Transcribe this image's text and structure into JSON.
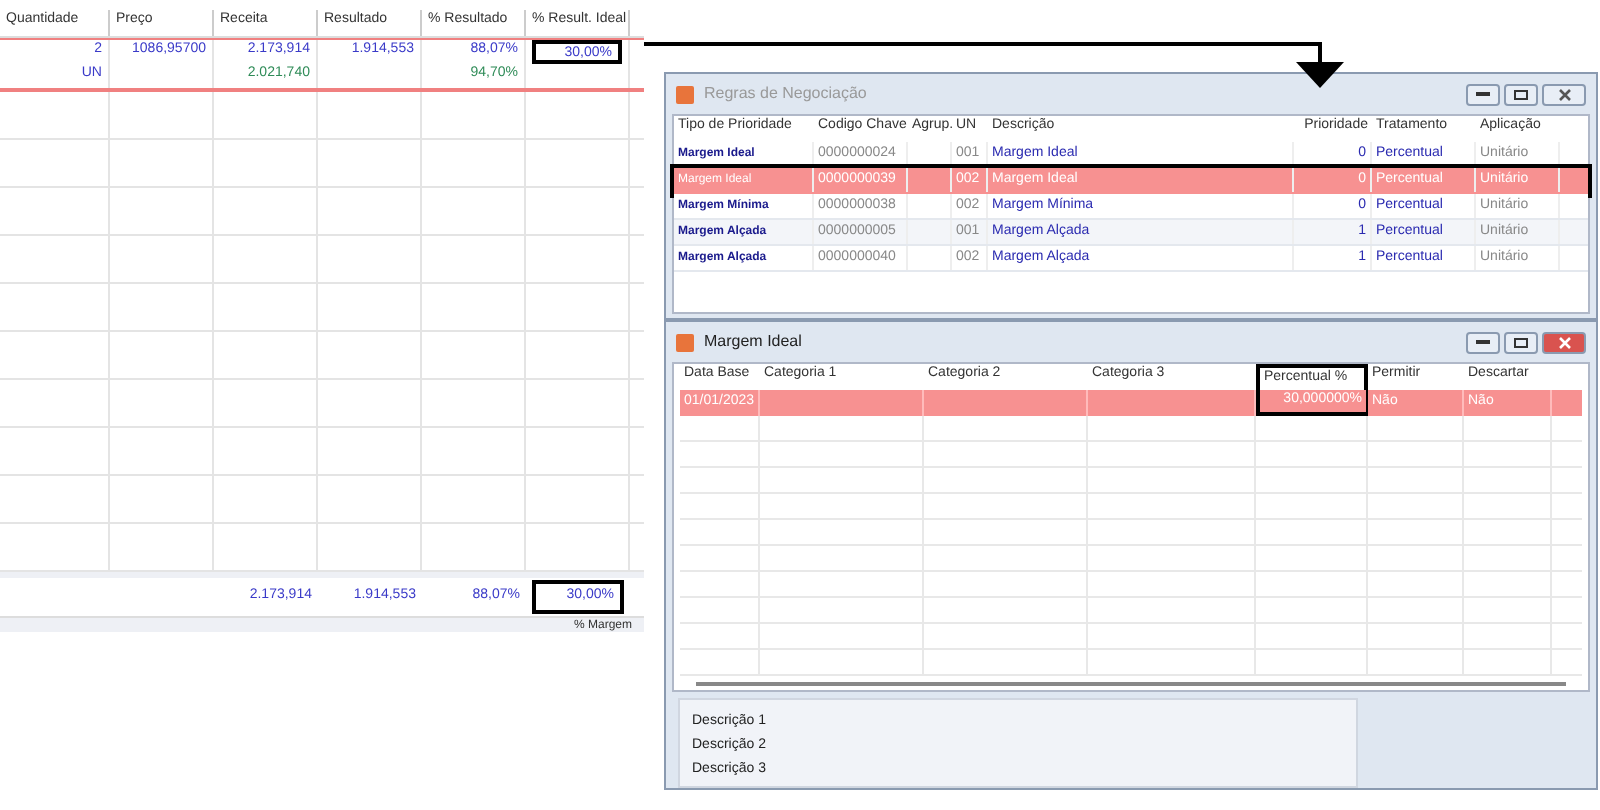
{
  "sheet": {
    "columns": [
      {
        "label": "Quantidade"
      },
      {
        "label": "Preço"
      },
      {
        "label": "Receita"
      },
      {
        "label": "Resultado"
      },
      {
        "label": "% Resultado"
      },
      {
        "label": "% Result. Ideal"
      }
    ],
    "rows": [
      {
        "cells": [
          {
            "text": "2",
            "color": "#3a3ac8"
          },
          {
            "text": "1086,95700",
            "color": "#3a3ac8"
          },
          {
            "text": "2.173,914",
            "color": "#3a3ac8"
          },
          {
            "text": "1.914,553",
            "color": "#3a3ac8"
          },
          {
            "text": "88,07%",
            "color": "#3a3ac8"
          },
          {
            "text": "30,00%",
            "color": "#3a3ac8",
            "boxed": true
          }
        ]
      },
      {
        "cells": [
          {
            "text": "UN",
            "color": "#3a3ac8"
          },
          null,
          {
            "text": "2.021,740",
            "color": "#2e8b57"
          },
          null,
          {
            "text": "94,70%",
            "color": "#2e8b57"
          },
          null
        ]
      }
    ],
    "totals": [
      {
        "text": "2.173,914"
      },
      {
        "text": "1.914,553"
      },
      {
        "text": "88,07%"
      },
      {
        "text": "30,00%",
        "boxed": true
      }
    ],
    "footer_label": "% Margem"
  },
  "rules_window": {
    "title": "Regras de Negociação",
    "columns": [
      "Tipo de Prioridade",
      "Codigo Chave",
      "Agrup.",
      "UN",
      "Descrição",
      "Prioridade",
      "Tratamento",
      "Aplicação"
    ],
    "rows": [
      {
        "cells": [
          "Margem Ideal",
          "0000000024",
          null,
          "001",
          "Margem Ideal",
          "0",
          "Percentual",
          "Unitário"
        ],
        "selected": false,
        "boxed": false
      },
      {
        "cells": [
          "Margem Ideal",
          "0000000039",
          null,
          "002",
          "Margem Ideal",
          "0",
          "Percentual",
          "Unitário"
        ],
        "selected": true,
        "boxed": true
      },
      {
        "cells": [
          "Margem Mínima",
          "0000000038",
          null,
          "002",
          "Margem Mínima",
          "0",
          "Percentual",
          "Unitário"
        ],
        "selected": false,
        "boxed": false
      },
      {
        "cells": [
          "Margem Alçada",
          "0000000005",
          null,
          "001",
          "Margem Alçada",
          "1",
          "Percentual",
          "Unitário"
        ],
        "selected": false,
        "boxed": false
      },
      {
        "cells": [
          "Margem Alçada",
          "0000000040",
          null,
          "002",
          "Margem Alçada",
          "1",
          "Percentual",
          "Unitário"
        ],
        "selected": false,
        "boxed": false
      }
    ]
  },
  "detail_window": {
    "title": "Margem Ideal",
    "columns": [
      {
        "label": "Data Base",
        "boxed": false
      },
      {
        "label": "Categoria 1",
        "boxed": false
      },
      {
        "label": "Categoria 2",
        "boxed": false
      },
      {
        "label": "Categoria 3",
        "boxed": false
      },
      {
        "label": "Percentual %",
        "boxed": true
      },
      {
        "label": "Permitir",
        "boxed": false
      },
      {
        "label": "Descartar",
        "boxed": false
      }
    ],
    "rows": [
      {
        "cells": [
          "01/01/2023",
          null,
          null,
          null,
          "30,000000%",
          "Não",
          "Não"
        ],
        "selected": true
      }
    ],
    "descriptions": [
      "Descrição 1",
      "Descrição 2",
      "Descrição 3"
    ]
  }
}
